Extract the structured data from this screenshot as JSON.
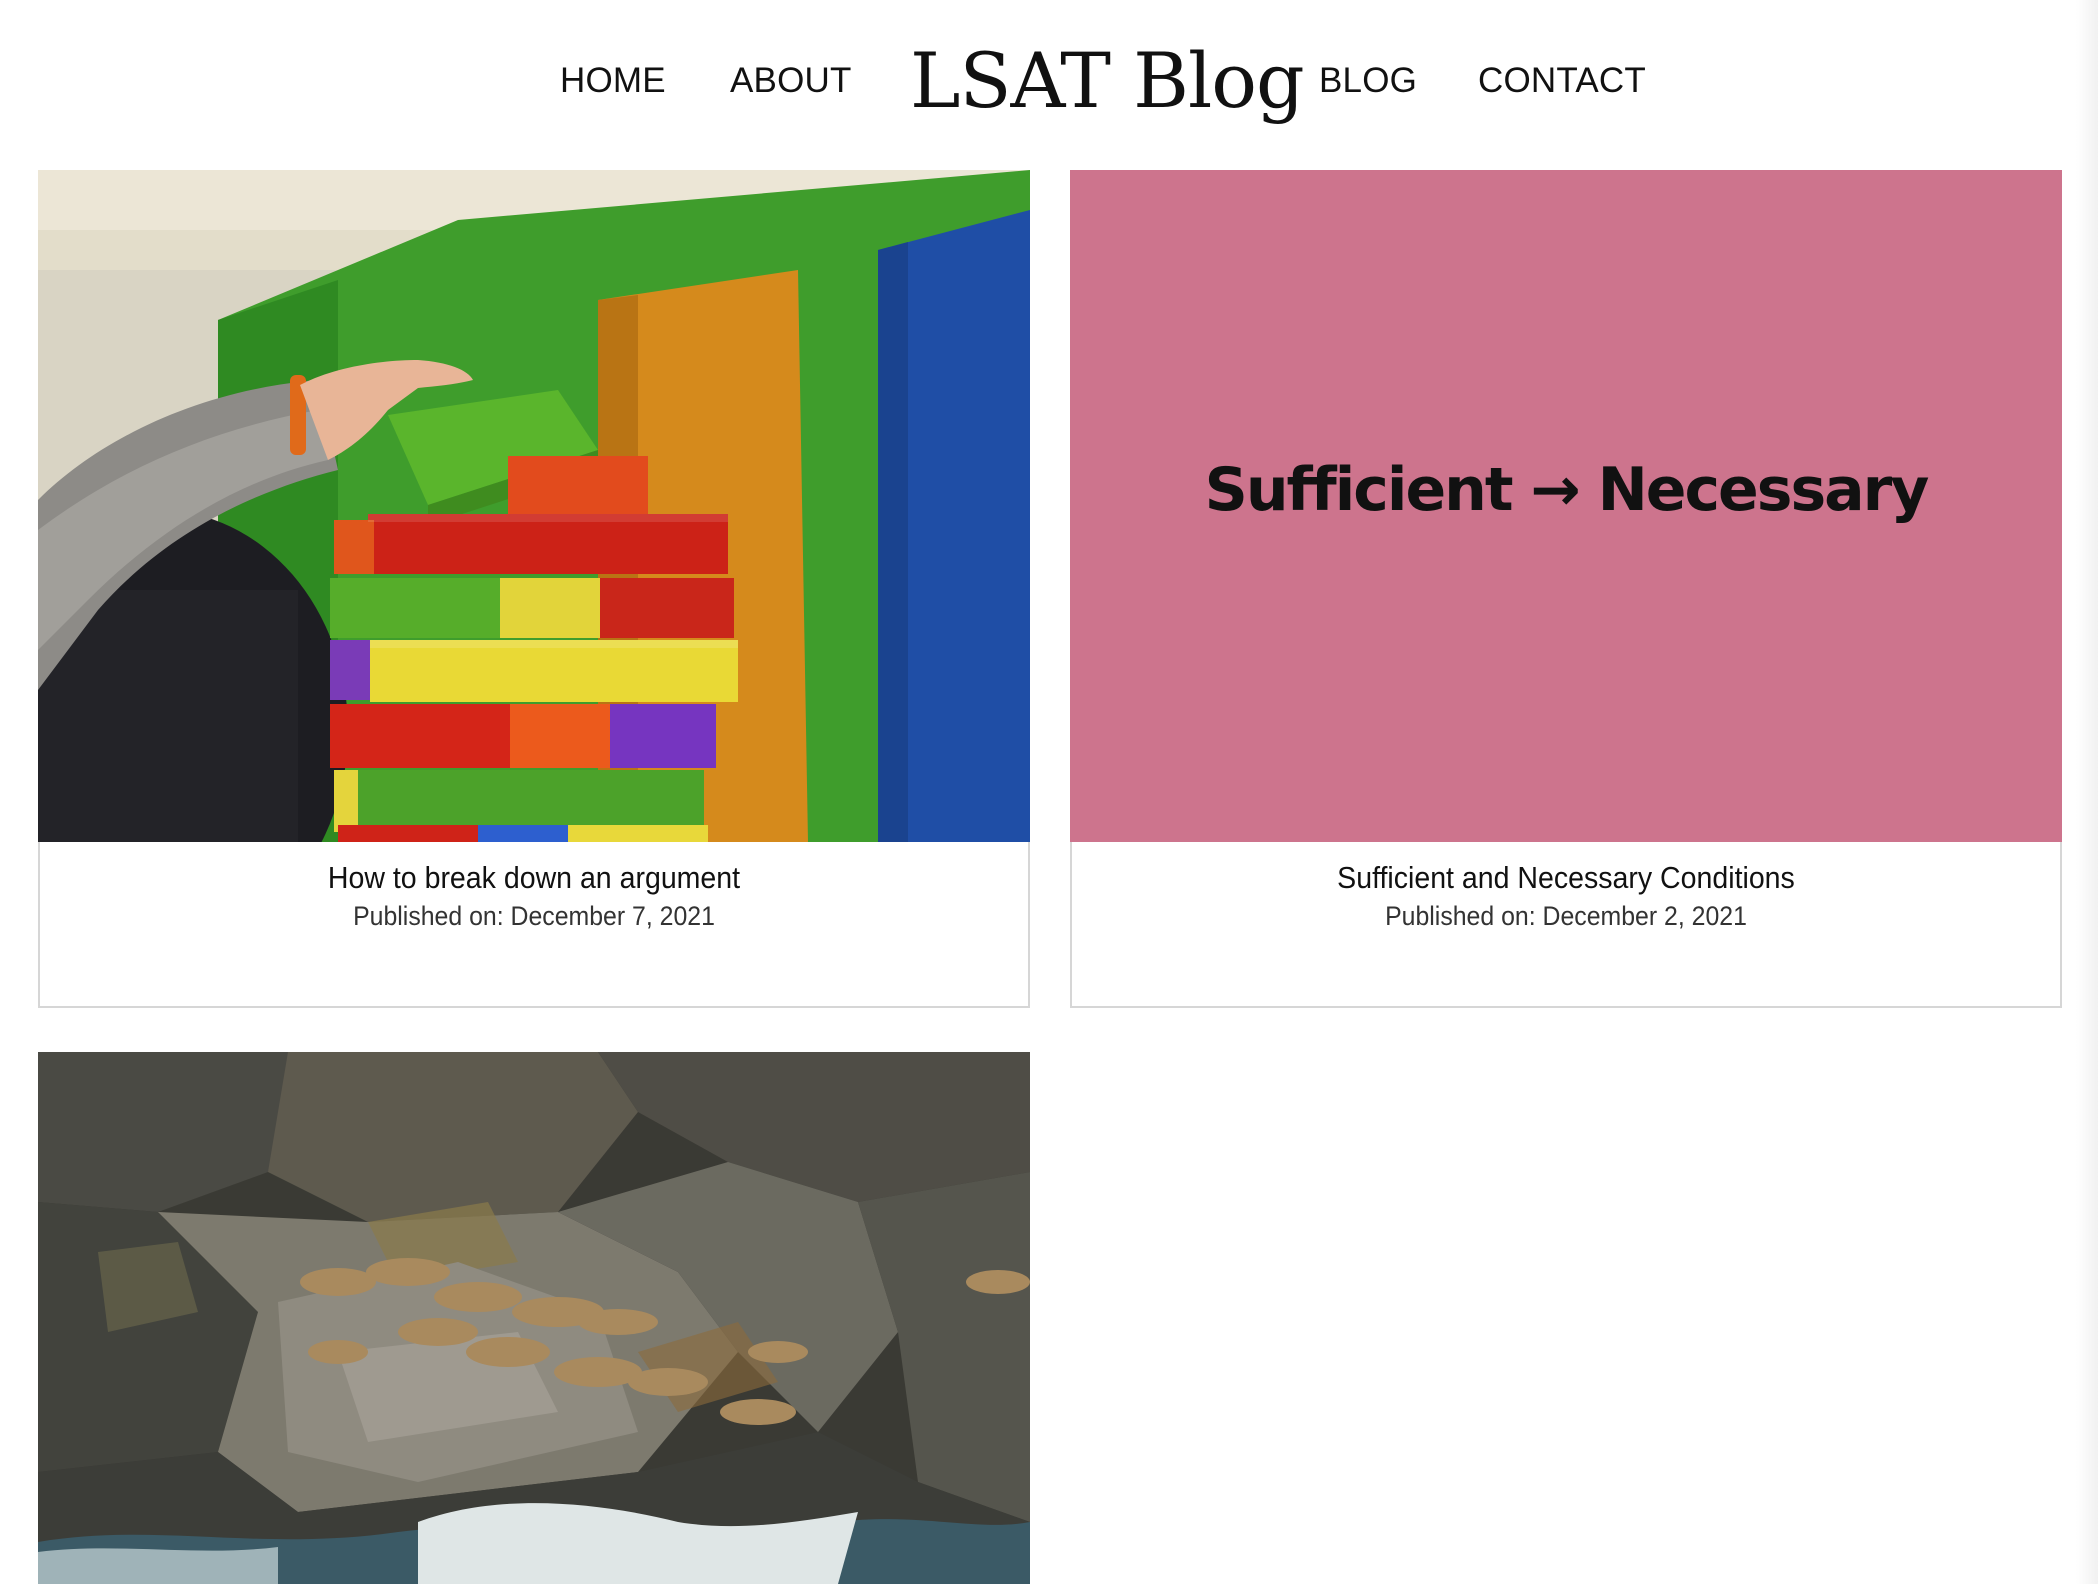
{
  "site": {
    "logo": "LSAT Blog",
    "nav": {
      "home": "HOME",
      "about": "ABOUT",
      "blog": "BLOG",
      "contact": "CONTACT"
    }
  },
  "posts": [
    {
      "title": "How to break down an argument",
      "date": "Published on: December 7, 2021",
      "image": "wooden-block-tower-photo"
    },
    {
      "title": "Sufficient and Necessary Conditions",
      "date": "Published on: December 2, 2021",
      "image_text": "Sufficient → Necessary",
      "image_color": "#cd748d"
    },
    {
      "image": "sea-lions-on-rocks-photo"
    }
  ]
}
